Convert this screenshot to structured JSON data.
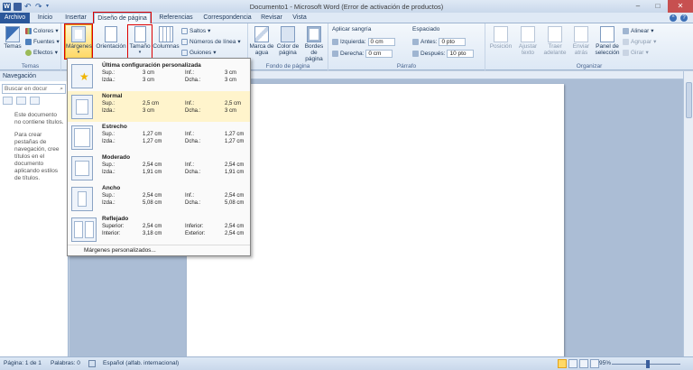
{
  "window": {
    "title": "Documento1 - Microsoft Word (Error de activación de productos)",
    "min": "–",
    "max": "□",
    "close": "✕"
  },
  "tabs": [
    {
      "label": "Archivo"
    },
    {
      "label": "Inicio"
    },
    {
      "label": "Insertar"
    },
    {
      "label": "Diseño de página"
    },
    {
      "label": "Referencias"
    },
    {
      "label": "Correspondencia"
    },
    {
      "label": "Revisar"
    },
    {
      "label": "Vista"
    }
  ],
  "ribbon": {
    "temas": {
      "label": "Temas",
      "colores": "Colores",
      "fuentes": "Fuentes",
      "efectos": "Efectos",
      "group": "Temas"
    },
    "config": {
      "margenes": "Márgenes",
      "orientacion": "Orientación",
      "tamano": "Tamaño",
      "columnas": "Columnas",
      "saltos": "Saltos",
      "numeros": "Números de línea",
      "guiones": "Guiones"
    },
    "fondo": {
      "marca": "Marca de agua",
      "color": "Color de página",
      "bordes": "Bordes de página",
      "group": "Fondo de página"
    },
    "parrafo": {
      "sangria": "Aplicar sangría",
      "espaciado": "Espaciado",
      "izq_label": "Izquierda:",
      "izq_val": "0 cm",
      "der_label": "Derecha:",
      "der_val": "0 cm",
      "antes_label": "Antes:",
      "antes_val": "0 pto",
      "despues_label": "Después:",
      "despues_val": "10 pto",
      "group": "Párrafo"
    },
    "organizar": {
      "posicion": "Posición",
      "ajustar": "Ajustar texto",
      "traer": "Traer adelante",
      "enviar": "Enviar atrás",
      "panel": "Panel de selección",
      "alinear": "Alinear",
      "agrupar": "Agrupar",
      "girar": "Girar",
      "group": "Organizar"
    }
  },
  "navigation": {
    "title": "Navegación",
    "search_placeholder": "Buscar en docur",
    "message1": "Este documento no contiene títulos.",
    "message2": "Para crear pestañas de navegación, cree títulos en el documento aplicando estilos de títulos."
  },
  "margins_menu": {
    "options": [
      {
        "title": "Última configuración personalizada",
        "l1a": "Sup.:",
        "v1a": "3 cm",
        "l1b": "Inf.:",
        "v1b": "3 cm",
        "l2a": "Izda.:",
        "v2a": "3 cm",
        "l2b": "Dcha.:",
        "v2b": "3 cm"
      },
      {
        "title": "Normal",
        "l1a": "Sup.:",
        "v1a": "2,5 cm",
        "l1b": "Inf.:",
        "v1b": "2,5 cm",
        "l2a": "Izda.:",
        "v2a": "3 cm",
        "l2b": "Dcha.:",
        "v2b": "3 cm"
      },
      {
        "title": "Estrecho",
        "l1a": "Sup.:",
        "v1a": "1,27 cm",
        "l1b": "Inf.:",
        "v1b": "1,27 cm",
        "l2a": "Izda.:",
        "v2a": "1,27 cm",
        "l2b": "Dcha.:",
        "v2b": "1,27 cm"
      },
      {
        "title": "Moderado",
        "l1a": "Sup.:",
        "v1a": "2,54 cm",
        "l1b": "Inf.:",
        "v1b": "2,54 cm",
        "l2a": "Izda.:",
        "v2a": "1,91 cm",
        "l2b": "Dcha.:",
        "v2b": "1,91 cm"
      },
      {
        "title": "Ancho",
        "l1a": "Sup.:",
        "v1a": "2,54 cm",
        "l1b": "Inf.:",
        "v1b": "2,54 cm",
        "l2a": "Izda.:",
        "v2a": "5,08 cm",
        "l2b": "Dcha.:",
        "v2b": "5,08 cm"
      },
      {
        "title": "Reflejado",
        "l1a": "Superior:",
        "v1a": "2,54 cm",
        "l1b": "Inferior:",
        "v1b": "2,54 cm",
        "l2a": "Interior:",
        "v2a": "3,18 cm",
        "l2b": "Exterior:",
        "v2b": "2,54 cm"
      }
    ],
    "custom": "Márgenes personalizados..."
  },
  "status": {
    "page": "Página: 1 de 1",
    "words": "Palabras: 0",
    "language": "Español (alfab. internacional)",
    "zoom": "95%",
    "zoom_level": 0.45
  }
}
